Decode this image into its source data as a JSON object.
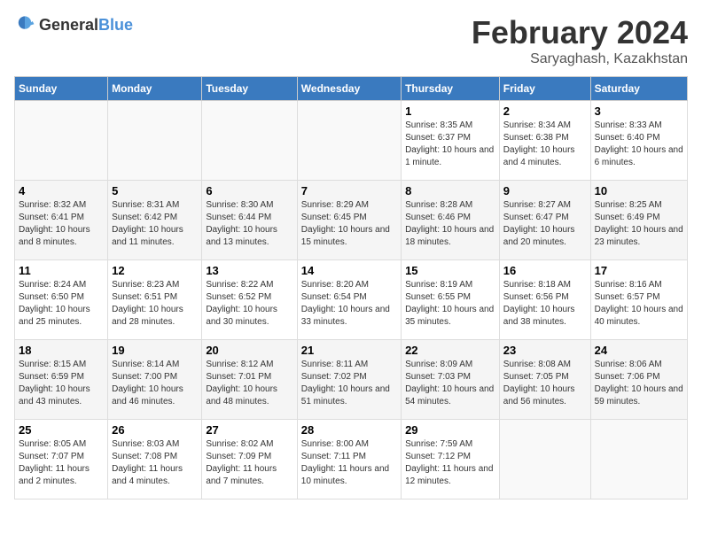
{
  "logo": {
    "general": "General",
    "blue": "Blue"
  },
  "title": "February 2024",
  "subtitle": "Saryaghash, Kazakhstan",
  "days_of_week": [
    "Sunday",
    "Monday",
    "Tuesday",
    "Wednesday",
    "Thursday",
    "Friday",
    "Saturday"
  ],
  "weeks": [
    [
      {
        "day": "",
        "info": ""
      },
      {
        "day": "",
        "info": ""
      },
      {
        "day": "",
        "info": ""
      },
      {
        "day": "",
        "info": ""
      },
      {
        "day": "1",
        "info": "Sunrise: 8:35 AM\nSunset: 6:37 PM\nDaylight: 10 hours and 1 minute."
      },
      {
        "day": "2",
        "info": "Sunrise: 8:34 AM\nSunset: 6:38 PM\nDaylight: 10 hours and 4 minutes."
      },
      {
        "day": "3",
        "info": "Sunrise: 8:33 AM\nSunset: 6:40 PM\nDaylight: 10 hours and 6 minutes."
      }
    ],
    [
      {
        "day": "4",
        "info": "Sunrise: 8:32 AM\nSunset: 6:41 PM\nDaylight: 10 hours and 8 minutes."
      },
      {
        "day": "5",
        "info": "Sunrise: 8:31 AM\nSunset: 6:42 PM\nDaylight: 10 hours and 11 minutes."
      },
      {
        "day": "6",
        "info": "Sunrise: 8:30 AM\nSunset: 6:44 PM\nDaylight: 10 hours and 13 minutes."
      },
      {
        "day": "7",
        "info": "Sunrise: 8:29 AM\nSunset: 6:45 PM\nDaylight: 10 hours and 15 minutes."
      },
      {
        "day": "8",
        "info": "Sunrise: 8:28 AM\nSunset: 6:46 PM\nDaylight: 10 hours and 18 minutes."
      },
      {
        "day": "9",
        "info": "Sunrise: 8:27 AM\nSunset: 6:47 PM\nDaylight: 10 hours and 20 minutes."
      },
      {
        "day": "10",
        "info": "Sunrise: 8:25 AM\nSunset: 6:49 PM\nDaylight: 10 hours and 23 minutes."
      }
    ],
    [
      {
        "day": "11",
        "info": "Sunrise: 8:24 AM\nSunset: 6:50 PM\nDaylight: 10 hours and 25 minutes."
      },
      {
        "day": "12",
        "info": "Sunrise: 8:23 AM\nSunset: 6:51 PM\nDaylight: 10 hours and 28 minutes."
      },
      {
        "day": "13",
        "info": "Sunrise: 8:22 AM\nSunset: 6:52 PM\nDaylight: 10 hours and 30 minutes."
      },
      {
        "day": "14",
        "info": "Sunrise: 8:20 AM\nSunset: 6:54 PM\nDaylight: 10 hours and 33 minutes."
      },
      {
        "day": "15",
        "info": "Sunrise: 8:19 AM\nSunset: 6:55 PM\nDaylight: 10 hours and 35 minutes."
      },
      {
        "day": "16",
        "info": "Sunrise: 8:18 AM\nSunset: 6:56 PM\nDaylight: 10 hours and 38 minutes."
      },
      {
        "day": "17",
        "info": "Sunrise: 8:16 AM\nSunset: 6:57 PM\nDaylight: 10 hours and 40 minutes."
      }
    ],
    [
      {
        "day": "18",
        "info": "Sunrise: 8:15 AM\nSunset: 6:59 PM\nDaylight: 10 hours and 43 minutes."
      },
      {
        "day": "19",
        "info": "Sunrise: 8:14 AM\nSunset: 7:00 PM\nDaylight: 10 hours and 46 minutes."
      },
      {
        "day": "20",
        "info": "Sunrise: 8:12 AM\nSunset: 7:01 PM\nDaylight: 10 hours and 48 minutes."
      },
      {
        "day": "21",
        "info": "Sunrise: 8:11 AM\nSunset: 7:02 PM\nDaylight: 10 hours and 51 minutes."
      },
      {
        "day": "22",
        "info": "Sunrise: 8:09 AM\nSunset: 7:03 PM\nDaylight: 10 hours and 54 minutes."
      },
      {
        "day": "23",
        "info": "Sunrise: 8:08 AM\nSunset: 7:05 PM\nDaylight: 10 hours and 56 minutes."
      },
      {
        "day": "24",
        "info": "Sunrise: 8:06 AM\nSunset: 7:06 PM\nDaylight: 10 hours and 59 minutes."
      }
    ],
    [
      {
        "day": "25",
        "info": "Sunrise: 8:05 AM\nSunset: 7:07 PM\nDaylight: 11 hours and 2 minutes."
      },
      {
        "day": "26",
        "info": "Sunrise: 8:03 AM\nSunset: 7:08 PM\nDaylight: 11 hours and 4 minutes."
      },
      {
        "day": "27",
        "info": "Sunrise: 8:02 AM\nSunset: 7:09 PM\nDaylight: 11 hours and 7 minutes."
      },
      {
        "day": "28",
        "info": "Sunrise: 8:00 AM\nSunset: 7:11 PM\nDaylight: 11 hours and 10 minutes."
      },
      {
        "day": "29",
        "info": "Sunrise: 7:59 AM\nSunset: 7:12 PM\nDaylight: 11 hours and 12 minutes."
      },
      {
        "day": "",
        "info": ""
      },
      {
        "day": "",
        "info": ""
      }
    ]
  ]
}
